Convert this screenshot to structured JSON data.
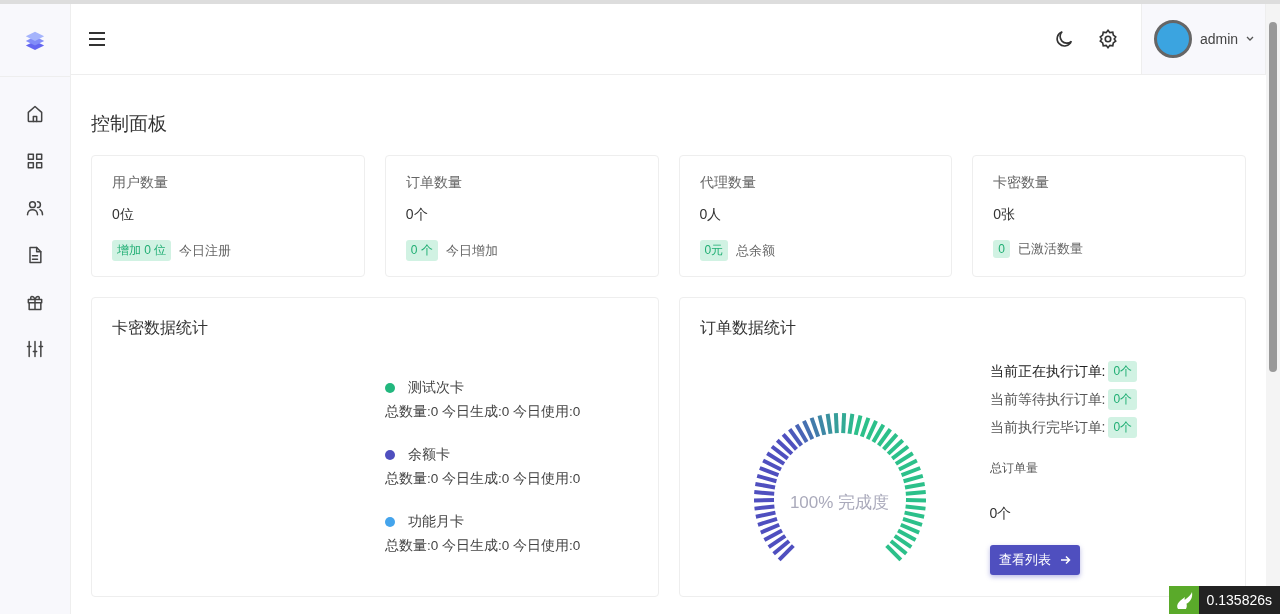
{
  "header": {
    "user": "admin"
  },
  "page_title": "控制面板",
  "stats": [
    {
      "label": "用户数量",
      "value": "0位",
      "badge": "增加 0 位",
      "note": "今日注册"
    },
    {
      "label": "订单数量",
      "value": "0个",
      "badge": "0 个",
      "note": "今日增加"
    },
    {
      "label": "代理数量",
      "value": "0人",
      "badge": "0元",
      "note": "总余额"
    },
    {
      "label": "卡密数量",
      "value": "0张",
      "badge": "0",
      "note": "已激活数量"
    }
  ],
  "card_stats": {
    "title": "卡密数据统计",
    "items": [
      {
        "name": "测试次卡",
        "color": "#22b77e",
        "detail": "总数量:0 今日生成:0 今日使用:0"
      },
      {
        "name": "余额卡",
        "color": "#4f4fbf",
        "detail": "总数量:0 今日生成:0 今日使用:0"
      },
      {
        "name": "功能月卡",
        "color": "#44a4ec",
        "detail": "总数量:0 今日生成:0 今日使用:0"
      }
    ]
  },
  "order_stats": {
    "title": "订单数据统计",
    "gauge": {
      "label": "100% 完成度"
    },
    "rows": [
      {
        "label": "当前正在执行订单:",
        "badge": "0个"
      },
      {
        "label": "当前等待执行订单:",
        "badge": "0个"
      },
      {
        "label": "当前执行完毕订单:",
        "badge": "0个"
      }
    ],
    "total_label": "总订单量",
    "total_value": "0个",
    "button": "查看列表"
  },
  "debug_timer": "0.135826s"
}
